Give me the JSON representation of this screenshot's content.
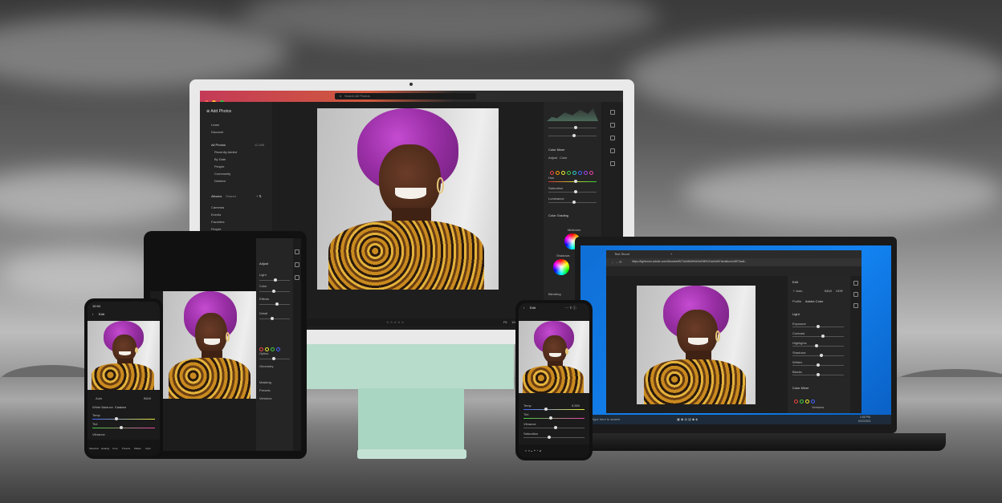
{
  "desktop": {
    "search_placeholder": "Search All Photos",
    "sidebar": {
      "add_photos": "Add Photos",
      "items": [
        "Learn",
        "Discover"
      ],
      "library": [
        "All Photos",
        "Recently Added",
        "By Date",
        "People",
        "Community",
        "Deleted"
      ],
      "all_photos_count": "12,406",
      "tabs": [
        "Albums",
        "Shared"
      ],
      "albums": [
        "Cameras",
        "Events",
        "Favorites",
        "People"
      ]
    },
    "panel": {
      "color_mixer": "Color Mixer",
      "color_grading": "Color Grading",
      "adjust_label": "Adjust",
      "adjust_value": "Color",
      "rows": [
        "Hue",
        "Saturation",
        "Luminance"
      ],
      "midtones": "Midtones",
      "shadows": "Shadows",
      "blending": "Blending",
      "highlights": "Highlights",
      "shadows_row": "Shadows",
      "fit": "Fit",
      "zoom": "100%"
    }
  },
  "laptop": {
    "tab_title": "Test Shoot",
    "url": "https://lightroom.adobe.com/libraries/f627dd4f6d9f4b3c928f91f1a0dd57ab/albums/8f72ac8...",
    "panel": {
      "edit": "Edit",
      "profile_label": "Profile",
      "profile_value": "Adobe Color",
      "auto": "Auto",
      "bw": "B&W",
      "hdr": "HDR",
      "light": "Light",
      "light_rows": [
        "Exposure",
        "Contrast",
        "Highlights",
        "Shadows",
        "Whites",
        "Blacks"
      ],
      "color_mixer": "Color Mixer",
      "bottom": "Versions"
    },
    "taskbar": {
      "search": "Type here to search",
      "time": "1:55 PM",
      "date": "6/22/2021"
    }
  },
  "tablet": {
    "panel": {
      "title": "Adjust",
      "rows": [
        "Light",
        "Color",
        "Effects",
        "Detail",
        "Optics",
        "Geometry"
      ],
      "bottom": [
        "Masking",
        "Presets",
        "Versions"
      ]
    }
  },
  "phone_left": {
    "status_time": "10:34",
    "edit_label": "Edit",
    "panel": {
      "wb_label": "White Balance",
      "wb_value": "Custom",
      "rows": [
        "Temp",
        "Tint",
        "Vibrance"
      ],
      "tools": [
        "Selective",
        "Healing",
        "Crop",
        "Presets",
        "Masks",
        "Light"
      ],
      "auto": "Auto",
      "bw": "B&W"
    }
  },
  "phone_right": {
    "edit_label": "Edit",
    "panel": {
      "rows": [
        "Temp",
        "Tint",
        "Vibrance",
        "Saturation"
      ],
      "temp_value": "5,550"
    }
  }
}
